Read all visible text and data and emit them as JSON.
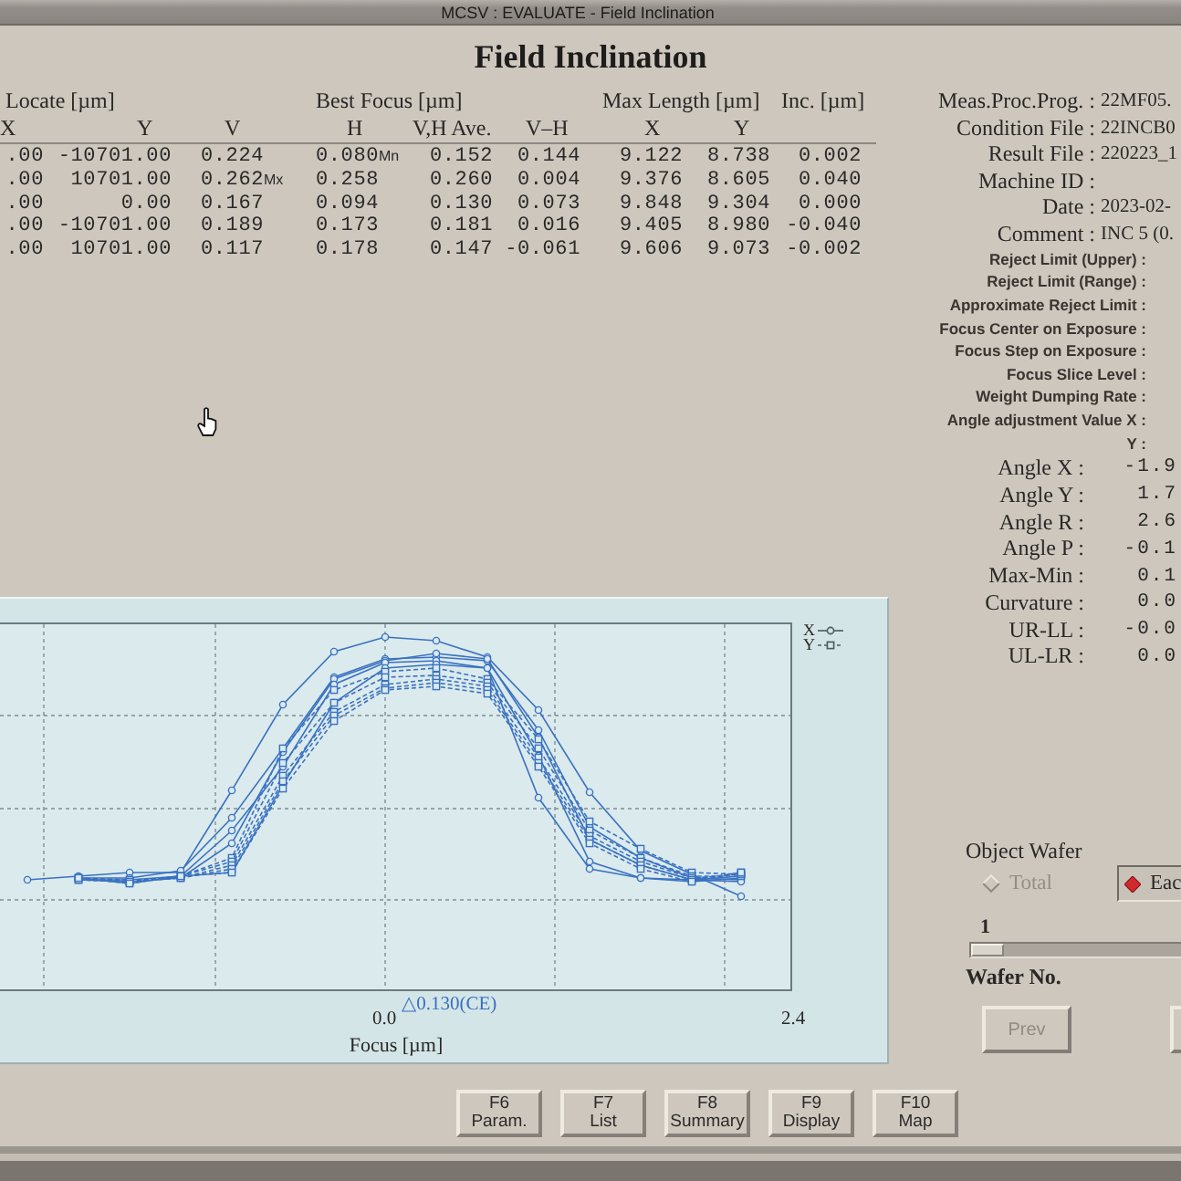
{
  "window": {
    "title": "MCSV : EVALUATE - Field Inclination"
  },
  "heading": "Field Inclination",
  "table": {
    "column_groups": [
      "Locate [µm]",
      "Best Focus [µm]",
      "Max Length [µm]",
      "Inc. [µm]"
    ],
    "columns": [
      "X",
      "Y",
      "V",
      "H",
      "V,H Ave.",
      "V–H",
      "X",
      "Y"
    ],
    "rows": [
      {
        "cells": [
          ".00",
          "-10701.00",
          "0.224",
          {
            "value": "0.080",
            "tag": "Mn"
          },
          "0.152",
          "0.144",
          "9.122",
          "8.738",
          "0.002"
        ]
      },
      {
        "cells": [
          ".00",
          "10701.00",
          {
            "value": "0.262",
            "tag": "Mx"
          },
          "0.258",
          "0.260",
          "0.004",
          "9.376",
          "8.605",
          "0.040"
        ]
      },
      {
        "cells": [
          ".00",
          "0.00",
          "0.167",
          "0.094",
          "0.130",
          "0.073",
          "9.848",
          "9.304",
          "0.000"
        ]
      },
      {
        "cells": [
          ".00",
          "-10701.00",
          "0.189",
          "0.173",
          "0.181",
          "0.016",
          "9.405",
          "8.980",
          "-0.040"
        ]
      },
      {
        "cells": [
          ".00",
          "10701.00",
          "0.117",
          "0.178",
          "0.147",
          "-0.061",
          "9.606",
          "9.073",
          "-0.002"
        ]
      }
    ]
  },
  "info": {
    "fields": [
      {
        "label": "Meas.Proc.Prog. :",
        "value": "22MF05."
      },
      {
        "label": "Condition File :",
        "value": "22INCB0"
      },
      {
        "label": "Result File :",
        "value": "220223_1"
      },
      {
        "label": "Machine ID :"
      },
      {
        "label": "Date :",
        "value": "2023-02-"
      },
      {
        "label": "Comment :",
        "value": "INC 5 (0."
      }
    ],
    "settings": [
      {
        "label": "Reject Limit (Upper) :"
      },
      {
        "label": "Reject Limit (Range) :"
      },
      {
        "label": "Approximate Reject Limit :"
      },
      {
        "label": "Focus Center on Exposure :"
      },
      {
        "label": "Focus Step on Exposure :"
      },
      {
        "label": "Focus Slice Level :"
      },
      {
        "label": "Weight Dumping Rate :"
      },
      {
        "label": "Angle adjustment Value X :"
      },
      {
        "label": "Y :"
      }
    ],
    "angles": [
      {
        "label": "Angle X :",
        "value": "-1.9"
      },
      {
        "label": "Angle Y :",
        "value": "1.7"
      },
      {
        "label": "Angle R :",
        "value": "2.6"
      },
      {
        "label": "Angle P :",
        "value": "-0.1"
      },
      {
        "label": "Max-Min :",
        "value": "0.1"
      },
      {
        "label": "Curvature :",
        "value": "0.0"
      },
      {
        "label": "UR-LL :",
        "value": "-0.0"
      },
      {
        "label": "UL-LR :",
        "value": "0.0"
      }
    ]
  },
  "chart": {
    "legend": [
      {
        "label": "X",
        "kind": "solid"
      },
      {
        "label": "Y",
        "kind": "dashed"
      }
    ],
    "annotation": "△0.130(CE)",
    "x_tick_labels": [
      "0.0",
      "2.4"
    ],
    "x_label": "Focus [µm]"
  },
  "object_wafer": {
    "title": "Object Wafer",
    "options": [
      {
        "label": "Total",
        "selected": false,
        "disabled": true
      },
      {
        "label": "Eac",
        "selected": true,
        "disabled": false
      }
    ],
    "slider": {
      "value": "1",
      "level": 0
    },
    "slider_label": "Wafer No.",
    "buttons": [
      {
        "label": "Prev",
        "disabled": true
      }
    ]
  },
  "function_keys": [
    {
      "key": "F6",
      "label": "Param."
    },
    {
      "key": "F7",
      "label": "List"
    },
    {
      "key": "F8",
      "label": "Summary"
    },
    {
      "key": "F9",
      "label": "Display"
    },
    {
      "key": "F10",
      "label": "Map"
    }
  ]
}
